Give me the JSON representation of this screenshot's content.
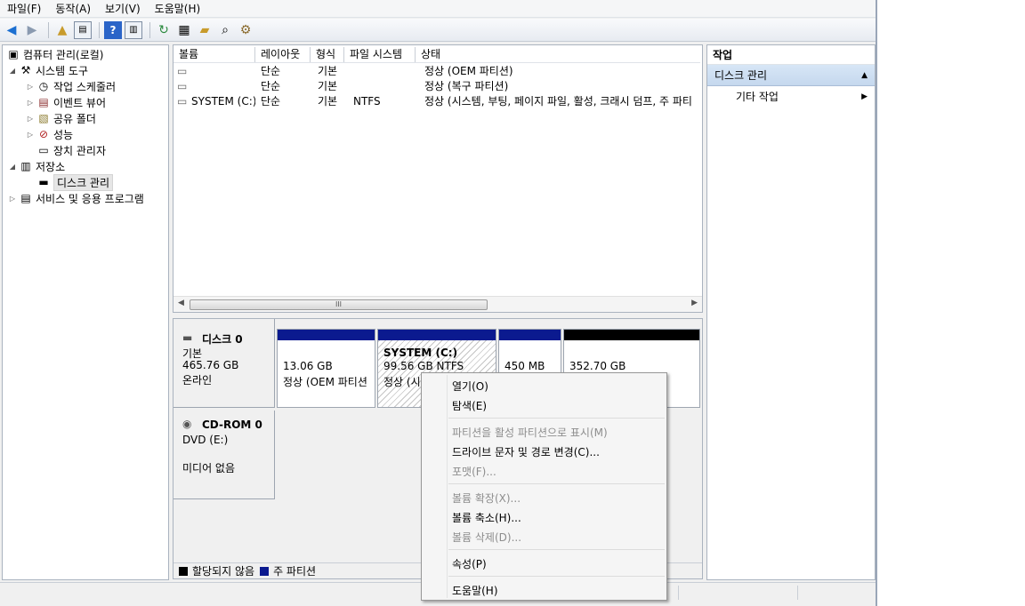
{
  "menu": [
    "파일(F)",
    "동작(A)",
    "보기(V)",
    "도움말(H)"
  ],
  "toolbar_icons": [
    "back-arrow-icon",
    "forward-arrow-icon",
    "up-folder-icon",
    "show-hide-tree-icon",
    "help-icon",
    "show-hide-action-icon",
    "refresh-icon",
    "properties-icon",
    "open-folder-icon",
    "search-icon",
    "settings-icon"
  ],
  "tree": {
    "root": "컴퓨터 관리(로컬)",
    "system_tools": "시스템 도구",
    "task_scheduler": "작업 스케줄러",
    "event_viewer": "이벤트 뷰어",
    "shared_folders": "공유 폴더",
    "performance": "성능",
    "device_manager": "장치 관리자",
    "storage": "저장소",
    "disk_management": "디스크 관리",
    "services": "서비스 및 응용 프로그램"
  },
  "list": {
    "columns": [
      "볼륨",
      "레이아웃",
      "형식",
      "파일 시스템",
      "상태"
    ],
    "rows": [
      {
        "volume": "",
        "layout": "단순",
        "type": "기본",
        "fs": "",
        "status": "정상 (OEM 파티션)"
      },
      {
        "volume": "",
        "layout": "단순",
        "type": "기본",
        "fs": "",
        "status": "정상 (복구 파티션)"
      },
      {
        "volume": "SYSTEM (C:)",
        "layout": "단순",
        "type": "기본",
        "fs": "NTFS",
        "status": "정상 (시스템, 부팅, 페이지 파일, 활성, 크래시 덤프, 주 파티"
      }
    ],
    "scroll_thumb": "III"
  },
  "disks": {
    "disk0": {
      "name": "디스크 0",
      "kind": "기본",
      "size": "465.76 GB",
      "state": "온라인"
    },
    "cdrom0": {
      "name": "CD-ROM 0",
      "kind": "DVD (E:)",
      "state": "미디어 없음"
    },
    "partitions": [
      {
        "size": "13.06 GB",
        "status": "정상 (OEM 파티션"
      },
      {
        "name": "SYSTEM  (C:)",
        "size": "99.56 GB NTFS",
        "status": "정상 (시"
      },
      {
        "size": "450 MB",
        "status": ""
      },
      {
        "size": "352.70 GB",
        "status": ""
      }
    ]
  },
  "legend": {
    "unallocated": "할당되지 않음",
    "primary": "주 파티션"
  },
  "actions": {
    "header": "작업",
    "section": "디스크 관리",
    "more": "기타 작업"
  },
  "context_menu": {
    "open": "열기(O)",
    "explore": "탐색(E)",
    "mark_active": "파티션을 활성 파티션으로 표시(M)",
    "change_letter": "드라이브 문자 및 경로 변경(C)...",
    "format": "포맷(F)...",
    "extend": "볼륨 확장(X)...",
    "shrink": "볼륨 축소(H)...",
    "delete": "볼륨 삭제(D)...",
    "properties": "속성(P)",
    "help": "도움말(H)"
  },
  "colors": {
    "primary_partition": "#0b1a8f",
    "unallocated": "#000000",
    "selection": "#c5d8ee"
  }
}
